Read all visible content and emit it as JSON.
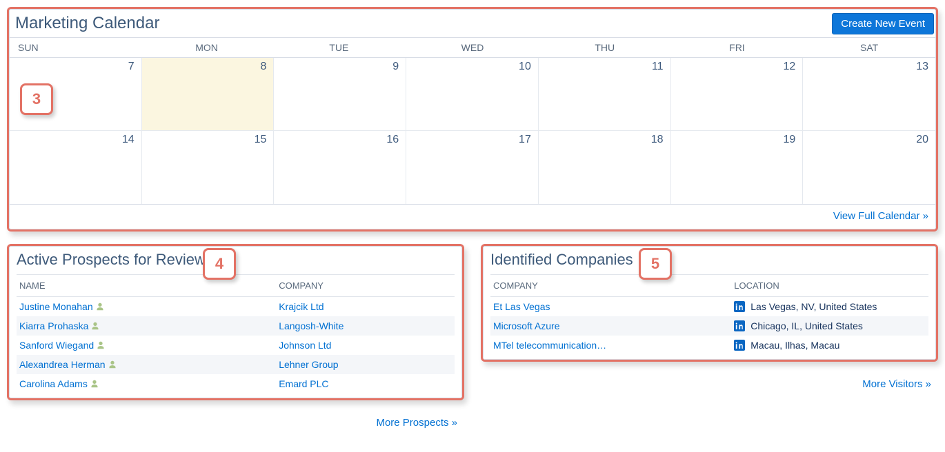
{
  "badges": {
    "b3": "3",
    "b4": "4",
    "b5": "5"
  },
  "calendar": {
    "title": "Marketing Calendar",
    "create_button": "Create New Event",
    "view_full": "View Full Calendar »",
    "day_names": [
      "SUN",
      "MON",
      "TUE",
      "WED",
      "THU",
      "FRI",
      "SAT"
    ],
    "weeks": [
      [
        {
          "num": "7",
          "today": false
        },
        {
          "num": "8",
          "today": true
        },
        {
          "num": "9",
          "today": false
        },
        {
          "num": "10",
          "today": false
        },
        {
          "num": "11",
          "today": false
        },
        {
          "num": "12",
          "today": false
        },
        {
          "num": "13",
          "today": false
        }
      ],
      [
        {
          "num": "14",
          "today": false
        },
        {
          "num": "15",
          "today": false
        },
        {
          "num": "16",
          "today": false
        },
        {
          "num": "17",
          "today": false
        },
        {
          "num": "18",
          "today": false
        },
        {
          "num": "19",
          "today": false
        },
        {
          "num": "20",
          "today": false
        }
      ]
    ]
  },
  "prospects": {
    "title": "Active Prospects for Review",
    "columns": {
      "name": "NAME",
      "company": "COMPANY"
    },
    "rows": [
      {
        "name": "Justine Monahan",
        "company": "Krajcik Ltd"
      },
      {
        "name": "Kiarra Prohaska",
        "company": "Langosh-White"
      },
      {
        "name": "Sanford Wiegand",
        "company": "Johnson Ltd"
      },
      {
        "name": "Alexandrea Herman",
        "company": "Lehner Group"
      },
      {
        "name": "Carolina Adams",
        "company": "Emard PLC"
      }
    ],
    "more": "More Prospects »"
  },
  "companies": {
    "title": "Identified Companies",
    "columns": {
      "company": "COMPANY",
      "location": "LOCATION"
    },
    "rows": [
      {
        "company": "Et Las Vegas",
        "location": "Las Vegas, NV, United States"
      },
      {
        "company": "Microsoft Azure",
        "location": "Chicago, IL, United States"
      },
      {
        "company": "MTel telecommunication…",
        "location": "Macau, Ilhas, Macau"
      }
    ],
    "more": "More Visitors »"
  }
}
